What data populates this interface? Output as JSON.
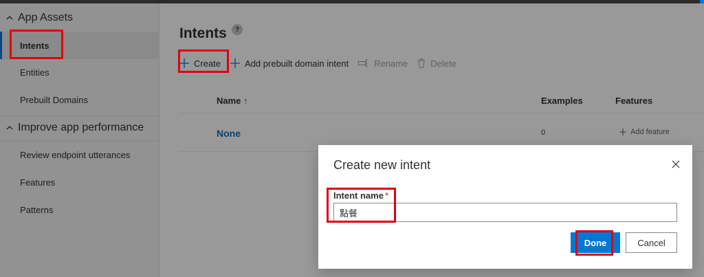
{
  "sidebar": {
    "sections": [
      {
        "label": "App Assets",
        "items": [
          {
            "label": "Intents",
            "active": true
          },
          {
            "label": "Entities",
            "active": false
          },
          {
            "label": "Prebuilt Domains",
            "active": false
          }
        ]
      },
      {
        "label": "Improve app performance",
        "items": [
          {
            "label": "Review endpoint utterances",
            "active": false
          },
          {
            "label": "Features",
            "active": false
          },
          {
            "label": "Patterns",
            "active": false
          }
        ]
      }
    ]
  },
  "main": {
    "title": "Intents",
    "help_glyph": "?",
    "toolbar": {
      "create": "Create",
      "add_prebuilt": "Add prebuilt domain intent",
      "rename": "Rename",
      "delete": "Delete"
    },
    "grid": {
      "columns": {
        "name": "Name",
        "sort_glyph": "↑",
        "examples": "Examples",
        "features": "Features"
      },
      "rows": [
        {
          "name": "None",
          "examples": "0",
          "features_action": "Add feature"
        }
      ]
    }
  },
  "dialog": {
    "title": "Create new intent",
    "field_label": "Intent name",
    "required_mark": "*",
    "field_value": "點餐",
    "done_label": "Done",
    "cancel_label": "Cancel"
  },
  "colors": {
    "accent": "#0078d4",
    "link": "#106ebe",
    "highlight": "#e0000f",
    "sidebar_bg": "#f4f4f4"
  }
}
